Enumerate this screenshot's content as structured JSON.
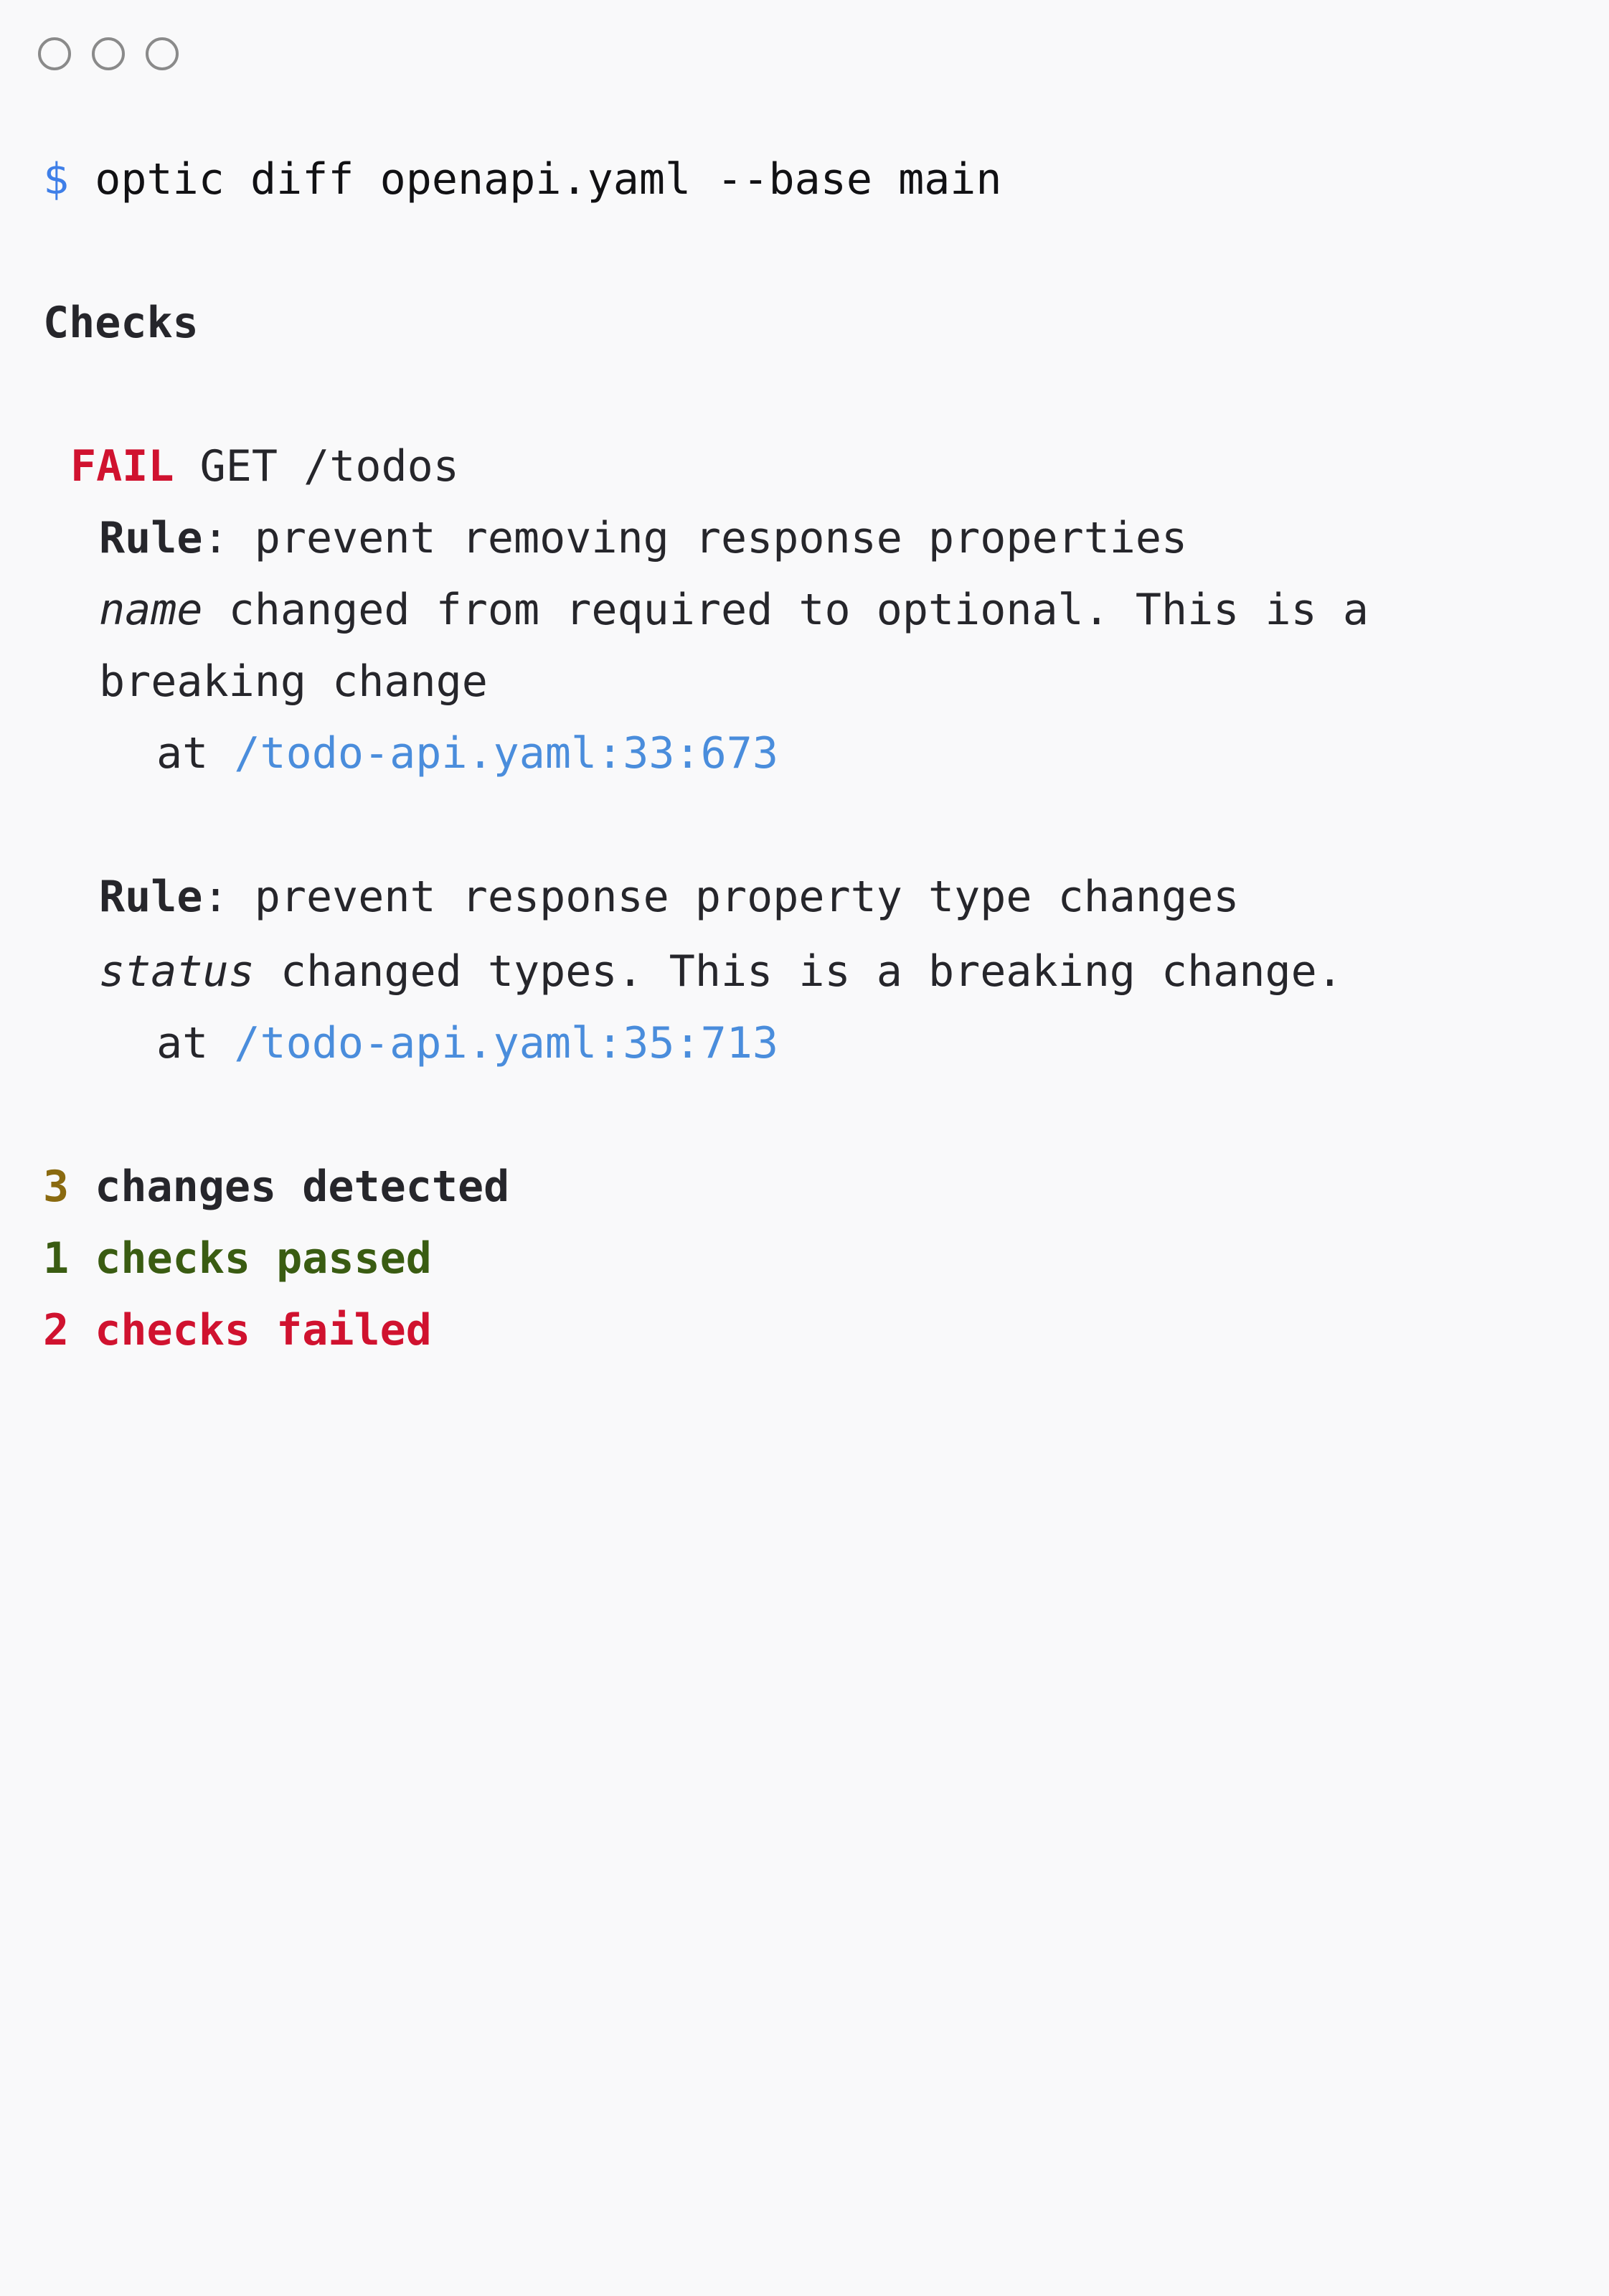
{
  "window": {
    "controls": [
      "close",
      "minimize",
      "maximize"
    ]
  },
  "command": {
    "prompt": "$",
    "text": "optic diff openapi.yaml --base main"
  },
  "checks_heading": "Checks",
  "endpoint": {
    "status": "FAIL",
    "method_path": "GET /todos"
  },
  "rules": [
    {
      "label": "Rule",
      "name": "prevent removing response properties",
      "property": "name",
      "message_line1": " changed from required to optional. This is a",
      "message_line2": "breaking change",
      "at": "at",
      "location": "/todo-api.yaml:33:673"
    },
    {
      "label": "Rule",
      "name": "prevent response property type changes",
      "property": "status",
      "message_line1": " changed types. This is a breaking change.",
      "at": "at",
      "location": "/todo-api.yaml:35:713"
    }
  ],
  "summary": {
    "changes_count": "3",
    "changes_text": "changes detected",
    "passed_count": "1",
    "passed_text": "checks passed",
    "failed_count": "2",
    "failed_text": "checks failed"
  },
  "colors": {
    "background": "#f9f9fa",
    "prompt": "#3f7fe8",
    "fail": "#d0122f",
    "link": "#4a8ddc",
    "changes_count": "#8a6a10",
    "passed": "#3a5c12"
  }
}
